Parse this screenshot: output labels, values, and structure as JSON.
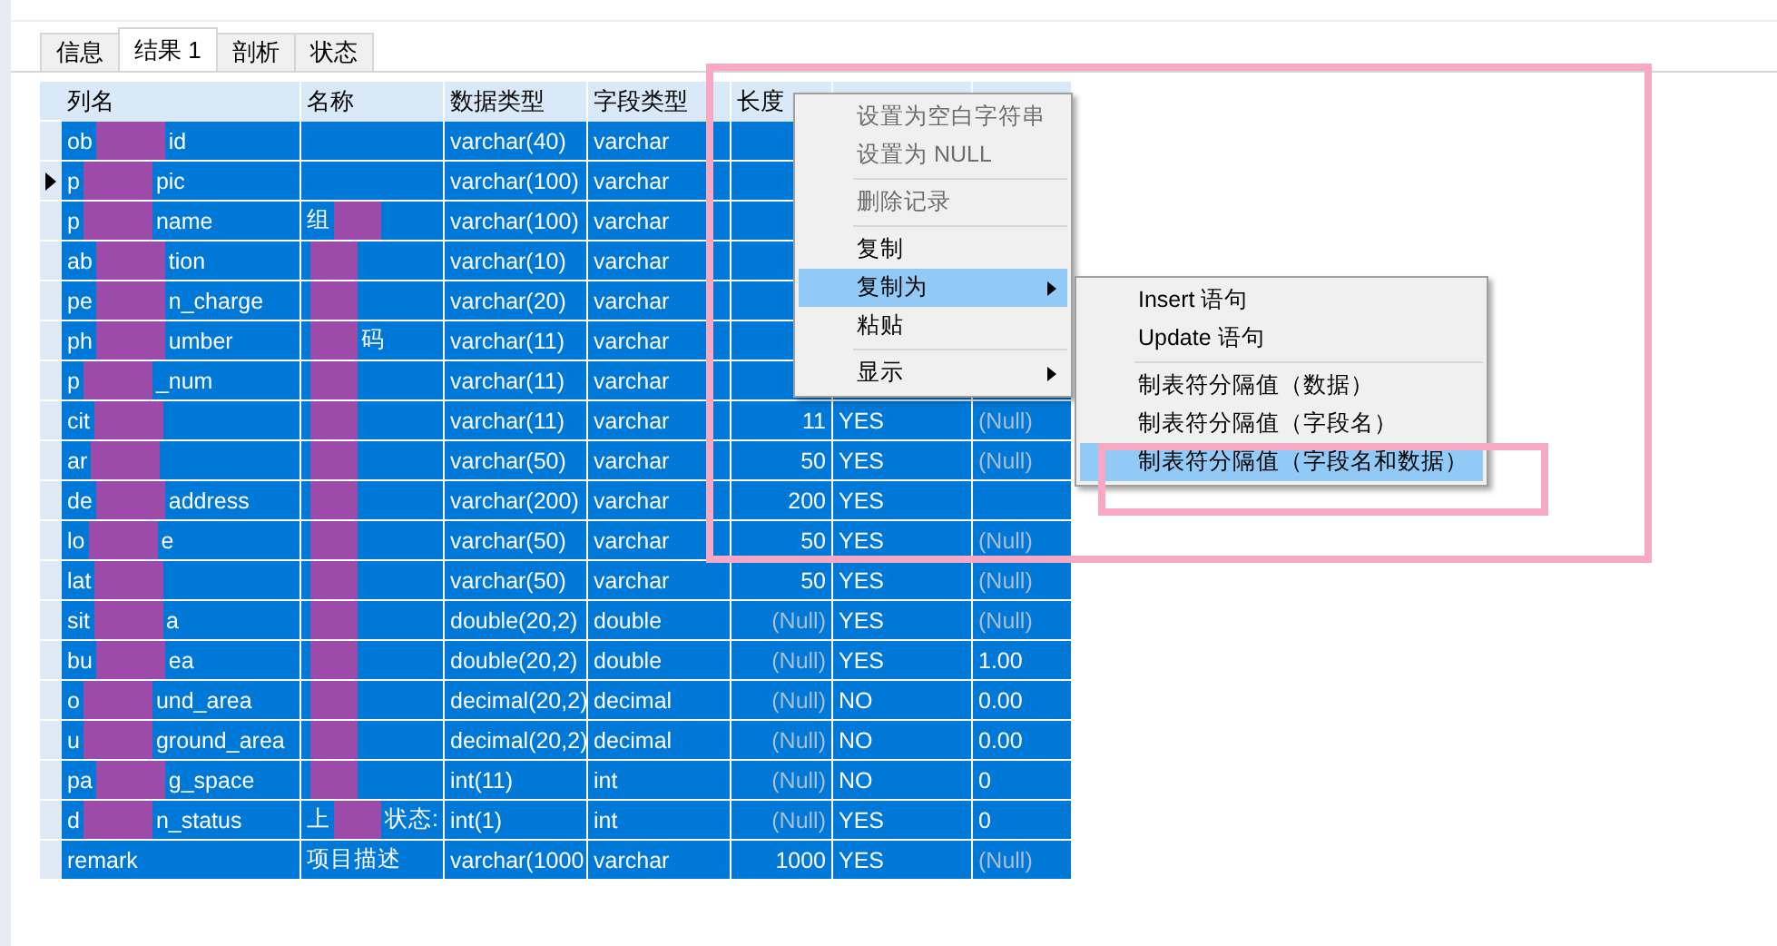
{
  "tabs": [
    {
      "label": "信息",
      "selected": false
    },
    {
      "label": "结果 1",
      "selected": true
    },
    {
      "label": "剖析",
      "selected": false
    },
    {
      "label": "状态",
      "selected": false
    }
  ],
  "columns": [
    "列名",
    "名称",
    "数据类型",
    "字段类型",
    "长度"
  ],
  "rows": [
    {
      "current": false,
      "name": {
        "left": "ob",
        "right": "id",
        "redacted": true
      },
      "type": "varchar(40)",
      "field_type": "varchar"
    },
    {
      "current": true,
      "name": {
        "left": "p",
        "right": "pic",
        "redacted": true
      },
      "type": "varchar(100)",
      "field_type": "varchar"
    },
    {
      "current": false,
      "name": {
        "left": "p",
        "right": "name",
        "redacted": true
      },
      "label": {
        "left": "组",
        "redacted": true
      },
      "type": "varchar(100)",
      "field_type": "varchar"
    },
    {
      "current": false,
      "name": {
        "left": "ab",
        "right": "tion",
        "redacted": true
      },
      "label": {
        "redacted": true
      },
      "type": "varchar(10)",
      "field_type": "varchar"
    },
    {
      "current": false,
      "name": {
        "left": "pe",
        "right": "n_charge",
        "redacted": true
      },
      "label": {
        "redacted": true
      },
      "type": "varchar(20)",
      "field_type": "varchar"
    },
    {
      "current": false,
      "name": {
        "left": "ph",
        "right": "umber",
        "redacted": true
      },
      "label": {
        "right": "码",
        "redacted": true
      },
      "type": "varchar(11)",
      "field_type": "varchar"
    },
    {
      "current": false,
      "name": {
        "left": "p",
        "right": "_num",
        "redacted": true
      },
      "label": {
        "redacted": true
      },
      "type": "varchar(11)",
      "field_type": "varchar"
    },
    {
      "current": false,
      "name": {
        "left": "cit",
        "redacted": true
      },
      "label": {
        "redacted": true
      },
      "type": "varchar(11)",
      "field_type": "varchar",
      "length": {
        "text": "11",
        "dim": false
      },
      "nullable": "YES",
      "default": {
        "text": "(Null)",
        "dim": true
      }
    },
    {
      "current": false,
      "name": {
        "left": "ar",
        "redacted": true
      },
      "label": {
        "redacted": true
      },
      "type": "varchar(50)",
      "field_type": "varchar",
      "length": {
        "text": "50",
        "dim": false
      },
      "nullable": "YES",
      "default": {
        "text": "(Null)",
        "dim": true
      }
    },
    {
      "current": false,
      "name": {
        "left": "de",
        "right": "address",
        "redacted": true
      },
      "label": {
        "redacted": true
      },
      "type": "varchar(200)",
      "field_type": "varchar",
      "length": {
        "text": "200",
        "dim": false
      },
      "nullable": "YES"
    },
    {
      "current": false,
      "name": {
        "left": "lo",
        "right": "e",
        "redacted": true
      },
      "label": {
        "redacted": true
      },
      "type": "varchar(50)",
      "field_type": "varchar",
      "length": {
        "text": "50",
        "dim": false
      },
      "nullable": "YES",
      "default": {
        "text": "(Null)",
        "dim": true
      }
    },
    {
      "current": false,
      "name": {
        "left": "lat",
        "redacted": true
      },
      "label": {
        "redacted": true
      },
      "type": "varchar(50)",
      "field_type": "varchar",
      "length": {
        "text": "50",
        "dim": false
      },
      "nullable": "YES",
      "default": {
        "text": "(Null)",
        "dim": true
      }
    },
    {
      "current": false,
      "name": {
        "left": "sit",
        "right": "a",
        "redacted": true
      },
      "label": {
        "redacted": true
      },
      "type": "double(20,2)",
      "field_type": "double",
      "length": {
        "text": "(Null)",
        "dim": true
      },
      "nullable": "YES",
      "default": {
        "text": "(Null)",
        "dim": true
      }
    },
    {
      "current": false,
      "name": {
        "left": "bu",
        "right": "ea",
        "redacted": true
      },
      "label": {
        "redacted": true
      },
      "type": "double(20,2)",
      "field_type": "double",
      "length": {
        "text": "(Null)",
        "dim": true
      },
      "nullable": "YES",
      "default": {
        "text": "1.00",
        "dim": false
      }
    },
    {
      "current": false,
      "name": {
        "left": "o",
        "right": "und_area",
        "redacted": true
      },
      "label": {
        "redacted": true
      },
      "type": "decimal(20,2)",
      "field_type": "decimal",
      "length": {
        "text": "(Null)",
        "dim": true
      },
      "nullable": "NO",
      "default": {
        "text": "0.00",
        "dim": false
      }
    },
    {
      "current": false,
      "name": {
        "left": "u",
        "right": "ground_area",
        "redacted": true
      },
      "label": {
        "redacted": true
      },
      "type": "decimal(20,2)",
      "field_type": "decimal",
      "length": {
        "text": "(Null)",
        "dim": true
      },
      "nullable": "NO",
      "default": {
        "text": "0.00",
        "dim": false
      }
    },
    {
      "current": false,
      "name": {
        "left": "pa",
        "right": "g_space",
        "redacted": true
      },
      "label": {
        "redacted": true
      },
      "type": "int(11)",
      "field_type": "int",
      "length": {
        "text": "(Null)",
        "dim": true
      },
      "nullable": "NO",
      "default": {
        "text": "0",
        "dim": false
      }
    },
    {
      "current": false,
      "name": {
        "left": "d",
        "right": "n_status",
        "redacted": true
      },
      "label": {
        "left": "上",
        "right": "状态:",
        "redacted": true
      },
      "type": "int(1)",
      "field_type": "int",
      "length": {
        "text": "(Null)",
        "dim": true
      },
      "nullable": "YES",
      "default": {
        "text": "0",
        "dim": false
      }
    },
    {
      "current": false,
      "name": {
        "left": "remark",
        "redacted": false
      },
      "label": {
        "left": "项目描述",
        "redacted": false
      },
      "type": "varchar(1000",
      "field_type": "varchar",
      "length": {
        "text": "1000",
        "dim": false
      },
      "nullable": "YES",
      "default": {
        "text": "(Null)",
        "dim": true
      }
    }
  ],
  "context_menu": [
    {
      "kind": "item",
      "label": "设置为空白字符串",
      "disabled": true,
      "highlighted": false,
      "submenu": false
    },
    {
      "kind": "item",
      "label": "设置为 NULL",
      "disabled": true,
      "highlighted": false,
      "submenu": false
    },
    {
      "kind": "separator"
    },
    {
      "kind": "item",
      "label": "删除记录",
      "disabled": true,
      "highlighted": false,
      "submenu": false
    },
    {
      "kind": "separator"
    },
    {
      "kind": "item",
      "label": "复制",
      "disabled": false,
      "highlighted": false,
      "submenu": false
    },
    {
      "kind": "item",
      "label": "复制为",
      "disabled": false,
      "highlighted": true,
      "submenu": true
    },
    {
      "kind": "item",
      "label": "粘贴",
      "disabled": false,
      "highlighted": false,
      "submenu": false
    },
    {
      "kind": "separator"
    },
    {
      "kind": "item",
      "label": "显示",
      "disabled": false,
      "highlighted": false,
      "submenu": true
    }
  ],
  "submenu": [
    {
      "kind": "item",
      "label": "Insert 语句",
      "highlighted": false
    },
    {
      "kind": "item",
      "label": "Update 语句",
      "highlighted": false
    },
    {
      "kind": "separator"
    },
    {
      "kind": "item",
      "label": "制表符分隔值（数据）",
      "highlighted": false
    },
    {
      "kind": "item",
      "label": "制表符分隔值（字段名）",
      "highlighted": false
    },
    {
      "kind": "item",
      "label": "制表符分隔值（字段名和数据）",
      "highlighted": true
    }
  ]
}
